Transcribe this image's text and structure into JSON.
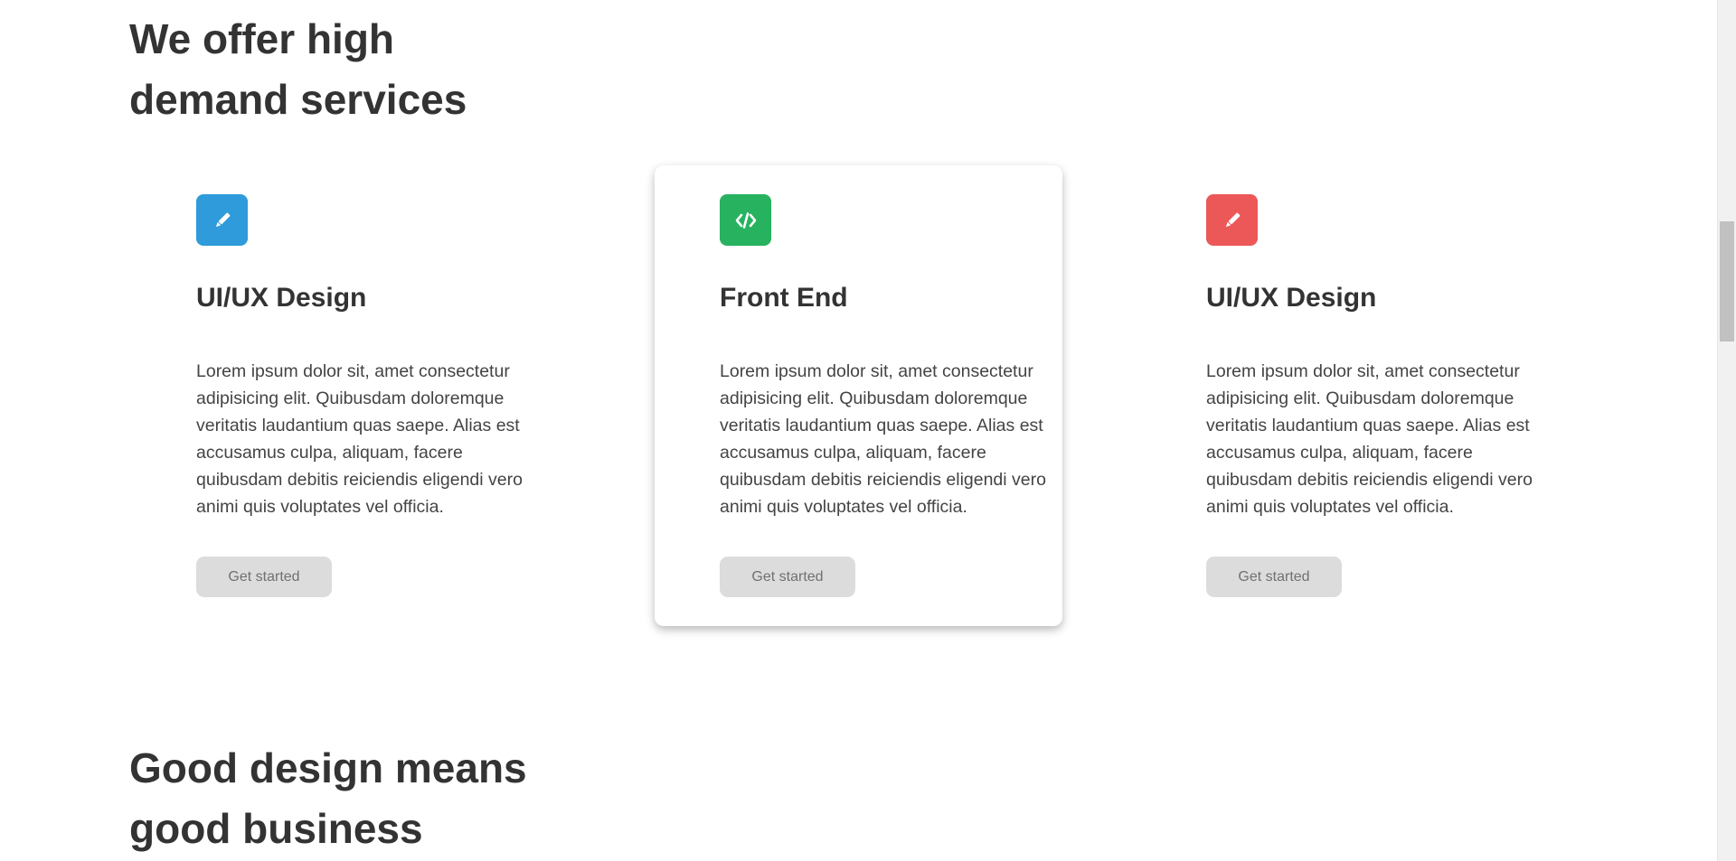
{
  "services_section": {
    "title_line1": "We offer high",
    "title_line2": "demand services",
    "cards": [
      {
        "icon": "pencil-icon",
        "icon_color": "#2f9bdb",
        "title": "UI/UX Design",
        "text": "Lorem ipsum dolor sit, amet consectetur adipisicing elit. Quibusdam doloremque veritatis laudantium quas saepe. Alias est accusamus culpa, aliquam, facere quibusdam debitis reiciendis eligendi vero animi quis voluptates vel officia.",
        "button_label": "Get started"
      },
      {
        "icon": "code-icon",
        "icon_color": "#27b25f",
        "title": "Front End",
        "text": "Lorem ipsum dolor sit, amet consectetur adipisicing elit. Quibusdam doloremque veritatis laudantium quas saepe. Alias est accusamus culpa, aliquam, facere quibusdam debitis reiciendis eligendi vero animi quis voluptates vel officia.",
        "button_label": "Get started"
      },
      {
        "icon": "pencil-icon",
        "icon_color": "#ec5858",
        "title": "UI/UX Design",
        "text": "Lorem ipsum dolor sit, amet consectetur adipisicing elit. Quibusdam doloremque veritatis laudantium quas saepe. Alias est accusamus culpa, aliquam, facere quibusdam debitis reiciendis eligendi vero animi quis voluptates vel officia.",
        "button_label": "Get started"
      }
    ]
  },
  "design_section": {
    "title_line1": "Good design means",
    "title_line2": "good business"
  },
  "colors": {
    "text": "#333333",
    "button_bg": "#dcdcdc",
    "button_text": "#707070"
  }
}
